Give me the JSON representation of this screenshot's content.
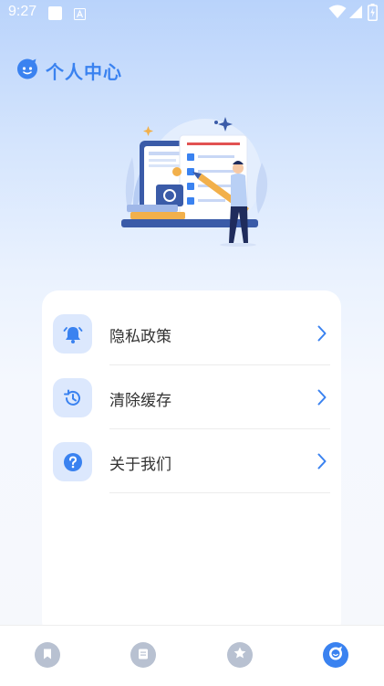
{
  "status_bar": {
    "time": "9:27"
  },
  "header": {
    "title": "个人中心",
    "icon": "smiley-face-icon"
  },
  "menu": [
    {
      "label": "隐私政策",
      "icon": "bell-icon"
    },
    {
      "label": "清除缓存",
      "icon": "history-icon"
    },
    {
      "label": "关于我们",
      "icon": "question-icon"
    }
  ],
  "tabbar": {
    "tabs": [
      {
        "icon": "bookmark-icon",
        "active": false
      },
      {
        "icon": "notes-icon",
        "active": false
      },
      {
        "icon": "star-icon",
        "active": false
      },
      {
        "icon": "profile-icon",
        "active": true
      }
    ]
  },
  "colors": {
    "accent": "#3a82f0",
    "icon_bg": "#dce8fd",
    "inactive_tab": "#b8c1d1"
  }
}
